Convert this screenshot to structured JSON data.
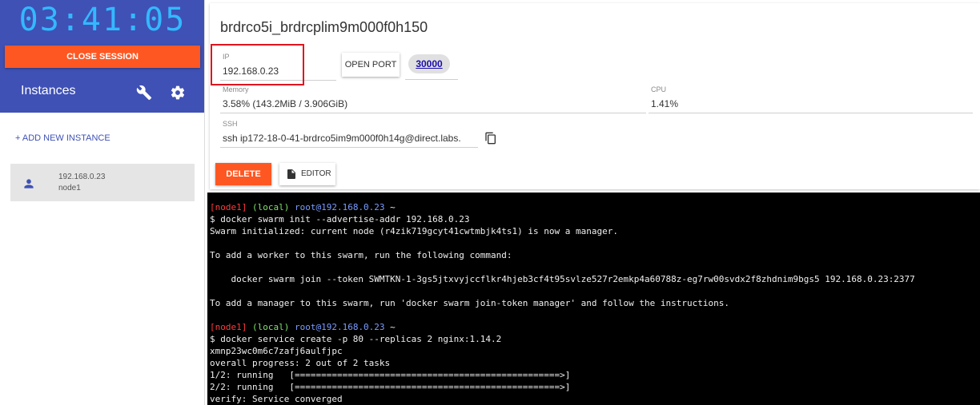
{
  "sidebar": {
    "clock": "03:41:05",
    "close_session_label": "CLOSE SESSION",
    "instances_title": "Instances",
    "add_instance_label": "+ ADD NEW INSTANCE",
    "instances": [
      {
        "ip": "192.168.0.23",
        "name": "node1"
      }
    ],
    "colors": {
      "header_bg": "#3f51b5",
      "clock": "#33b8ff",
      "accent": "#ff5722"
    }
  },
  "main": {
    "session_title": "brdrco5i_brdrcplim9m000f0h150",
    "ip": {
      "label": "IP",
      "value": "192.168.0.23"
    },
    "open_port_label": "OPEN PORT",
    "port_badge": "30000",
    "memory": {
      "label": "Memory",
      "value": "3.58% (143.2MiB / 3.906GiB)"
    },
    "cpu": {
      "label": "CPU",
      "value": "1.41%"
    },
    "ssh": {
      "label": "SSH",
      "value": "ssh ip172-18-0-41-brdrco5im9m000f0h14g@direct.labs."
    },
    "delete_label": "DELETE",
    "editor_label": "EDITOR"
  },
  "terminal": {
    "prompt1": {
      "node": "[node1]",
      "scope": "(local)",
      "host": "root@192.168.0.23",
      "suffix": " ~"
    },
    "cmd1_prefix": "$ docker swarm init --advertise-addr ",
    "cmd1_addr": "192.168.0.23",
    "line_swarm_init": "Swarm initialized: current node (r4zik719gcyt41cwtmbjk4ts1) is now a manager.",
    "line_add_worker": "To add a worker to this swarm, run the following command:",
    "line_join_cmd": "    docker swarm join --token SWMTKN-1-3gs5jtxvyjccflkr4hjeb3cf4t95svlze527r2emkp4a60788z-eg7rw00svdx2f8zhdnim9bgs5 192.168.0.23:2377",
    "line_add_manager": "To add a manager to this swarm, run 'docker swarm join-token manager' and follow the instructions.",
    "prompt2": {
      "node": "[node1]",
      "scope": "(local)",
      "host": "root@192.168.0.23",
      "suffix": " ~"
    },
    "cmd2": "$ docker service create -p 80 --replicas 2 nginx:1.14.2",
    "line_service_id": "xmnp23wc0m6c7zafj6aulfjpc",
    "line_progress": "overall progress: 2 out of 2 tasks",
    "line_task1": "1/2: running   [==================================================>]",
    "line_task2": "2/2: running   [==================================================>]",
    "line_verify": "verify: Service converged"
  }
}
